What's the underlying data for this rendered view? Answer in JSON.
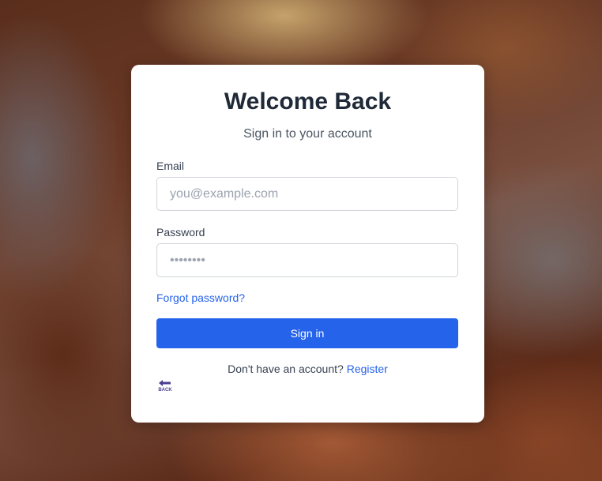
{
  "login": {
    "title": "Welcome Back",
    "subtitle": "Sign in to your account",
    "email_label": "Email",
    "email_placeholder": "you@example.com",
    "email_value": "",
    "password_label": "Password",
    "password_placeholder": "••••••••",
    "password_value": "",
    "forgot_link": "Forgot password?",
    "signin_button": "Sign in",
    "register_prompt": "Don't have an account?",
    "register_link": "Register",
    "back_label": "BACK",
    "back_icon": "back-arrow-icon"
  },
  "colors": {
    "accent": "#2563eb",
    "title": "#1f2937",
    "back_icon": "#4b3f8f"
  }
}
